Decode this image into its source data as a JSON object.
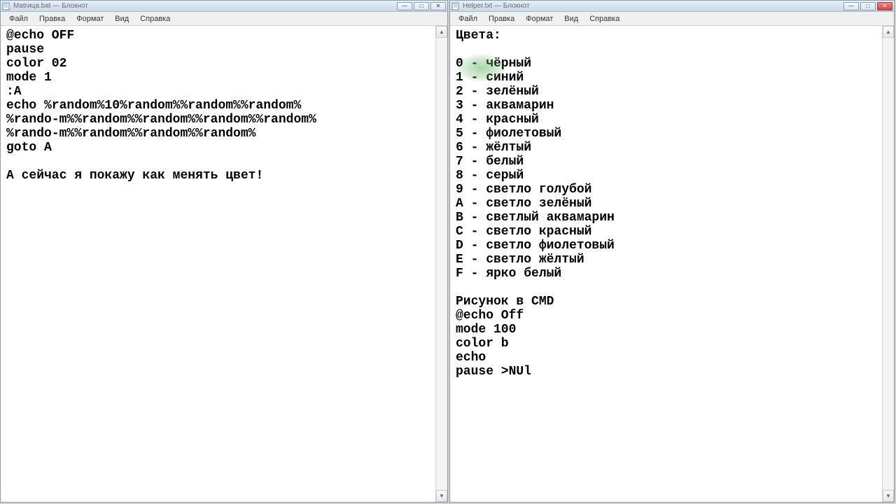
{
  "left": {
    "title": "Matrица.bat — Блокнот",
    "menu": [
      "Файл",
      "Правка",
      "Формат",
      "Вид",
      "Справка"
    ],
    "content": "@echo OFF\npause\ncolor 02\nmode 1\n:A\necho %random%10%random%%random%%random%\n%rando-m%%random%%random%%random%%random%\n%rando-m%%random%%random%%random%\ngoto A\n\nА сейчас я покажу как менять цвет!"
  },
  "right": {
    "title": "Helper.txt — Блокнот",
    "menu": [
      "Файл",
      "Правка",
      "Формат",
      "Вид",
      "Справка"
    ],
    "content": "Цвета:\n\n0 - чёрный\n1 - синий\n2 - зелёный\n3 - аквамарин\n4 - красный\n5 - фиолетовый\n6 - жёлтый\n7 - белый\n8 - серый\n9 - светло голубой\nA - светло зелёный\nB - светлый аквамарин\nC - светло красный\nD - светло фиолетовый\nE - светло жёлтый\nF - ярко белый\n\nРисунок в CMD\n@echo Off\nmode 100\ncolor b\necho\npause >NUl"
  },
  "winbtns": {
    "min": "—",
    "max": "□",
    "close": "✕"
  },
  "scroll": {
    "up": "▲",
    "down": "▼"
  }
}
